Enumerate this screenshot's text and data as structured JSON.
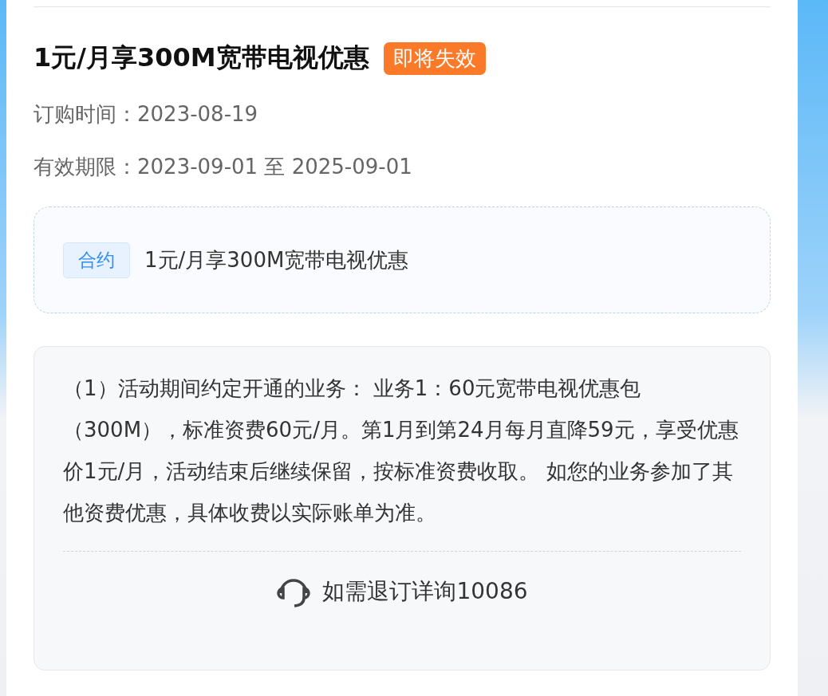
{
  "offer": {
    "title": "1元/月享300M宽带电视优惠",
    "badge": "即将失效",
    "fields": [
      {
        "text": "订购时间：2023-08-19"
      },
      {
        "text": "有效期限：2023-09-01 至 2025-09-01"
      }
    ]
  },
  "contract": {
    "tag": "合约",
    "name": "1元/月享300M宽带电视优惠"
  },
  "description": {
    "text": "（1）活动期间约定开通的业务： 业务1：60元宽带电视优惠包（300M），标准资费60元/月。第1月到第24月每月直降59元，享受优惠价1元/月，活动结束后继续保留，按标准资费收取。 如您的业务参加了其他资费优惠，具体收费以实际账单为准。",
    "contact": "如需退订详询10086"
  }
}
